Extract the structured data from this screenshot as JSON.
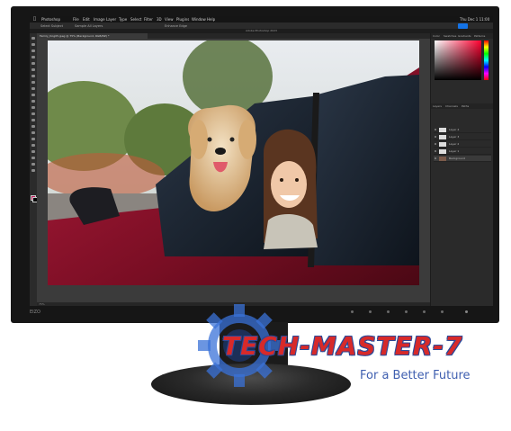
{
  "app": {
    "menubar": {
      "app_name": "Photoshop",
      "items": [
        "File",
        "Edit",
        "Image",
        "Layer",
        "Type",
        "Select",
        "Filter",
        "3D",
        "View",
        "Plugins",
        "Window",
        "Help"
      ],
      "clock": "Thu Dec 1 11:00"
    },
    "options_bar": {
      "items": [
        "Select Subject",
        "Sample All Layers",
        "Enhance Edge"
      ]
    },
    "window_title": "Adobe Photoshop 2023",
    "doc_tab": "Family_Dog05.jpeg @ 75% (Background, RGB/8#) *",
    "status_text": "75%",
    "panel_tabs": [
      "Color",
      "Swatches",
      "Gradients",
      "Patterns"
    ],
    "layers_tabs": [
      "Layers",
      "Channels",
      "Paths"
    ],
    "layers": [
      {
        "name": "Layer 4"
      },
      {
        "name": "Layer 3"
      },
      {
        "name": "Layer 2"
      },
      {
        "name": "Layer 1"
      },
      {
        "name": "Background"
      }
    ],
    "fg_color": "#c2185b",
    "bg_color": "#000000"
  },
  "monitor": {
    "brand": "EIZO"
  },
  "watermark": {
    "title": "TECH-MASTER-7",
    "tagline": "For a Better Future"
  }
}
